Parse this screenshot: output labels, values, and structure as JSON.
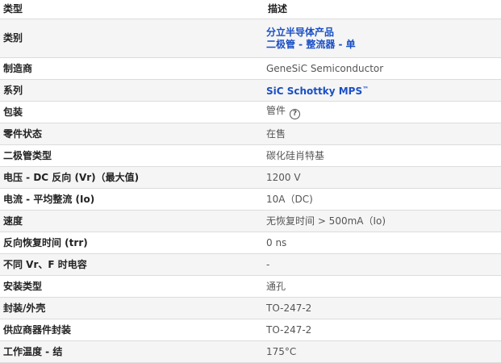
{
  "header": {
    "col_type": "类型",
    "col_desc": "描述"
  },
  "rows": [
    {
      "label": "类别",
      "value_line1": "分立半导体产品",
      "value_line2": "二极管 - 整流器 - 单"
    },
    {
      "label": "制造商",
      "value": "GeneSiC Semiconductor"
    },
    {
      "label": "系列",
      "value": "SiC Schottky MPS",
      "value_suffix": "™"
    },
    {
      "label": "包装",
      "value": "管件",
      "help_icon": "question-circle-icon",
      "help_glyph": "?"
    },
    {
      "label": "零件状态",
      "value": "在售"
    },
    {
      "label": "二极管类型",
      "value": "碳化硅肖特基"
    },
    {
      "label": "电压 - DC 反向 (Vr)（最大值)",
      "value": "1200 V"
    },
    {
      "label": "电流 - 平均整流 (Io)",
      "value": "10A（DC)"
    },
    {
      "label": "速度",
      "value": "无恢复时间 > 500mA（Io)"
    },
    {
      "label": "反向恢复时间 (trr)",
      "value": "0 ns"
    },
    {
      "label": "不同 Vr、F 时电容",
      "value": "-"
    },
    {
      "label": "安装类型",
      "value": "通孔"
    },
    {
      "label": "封装/外壳",
      "value": "TO-247-2"
    },
    {
      "label": "供应商器件封装",
      "value": "TO-247-2"
    },
    {
      "label": "工作温度 - 结",
      "value": "175°C"
    }
  ],
  "colors": {
    "link": "#1a4fc4",
    "stripe": "#f5f5f5",
    "border": "#dcdcdc"
  }
}
